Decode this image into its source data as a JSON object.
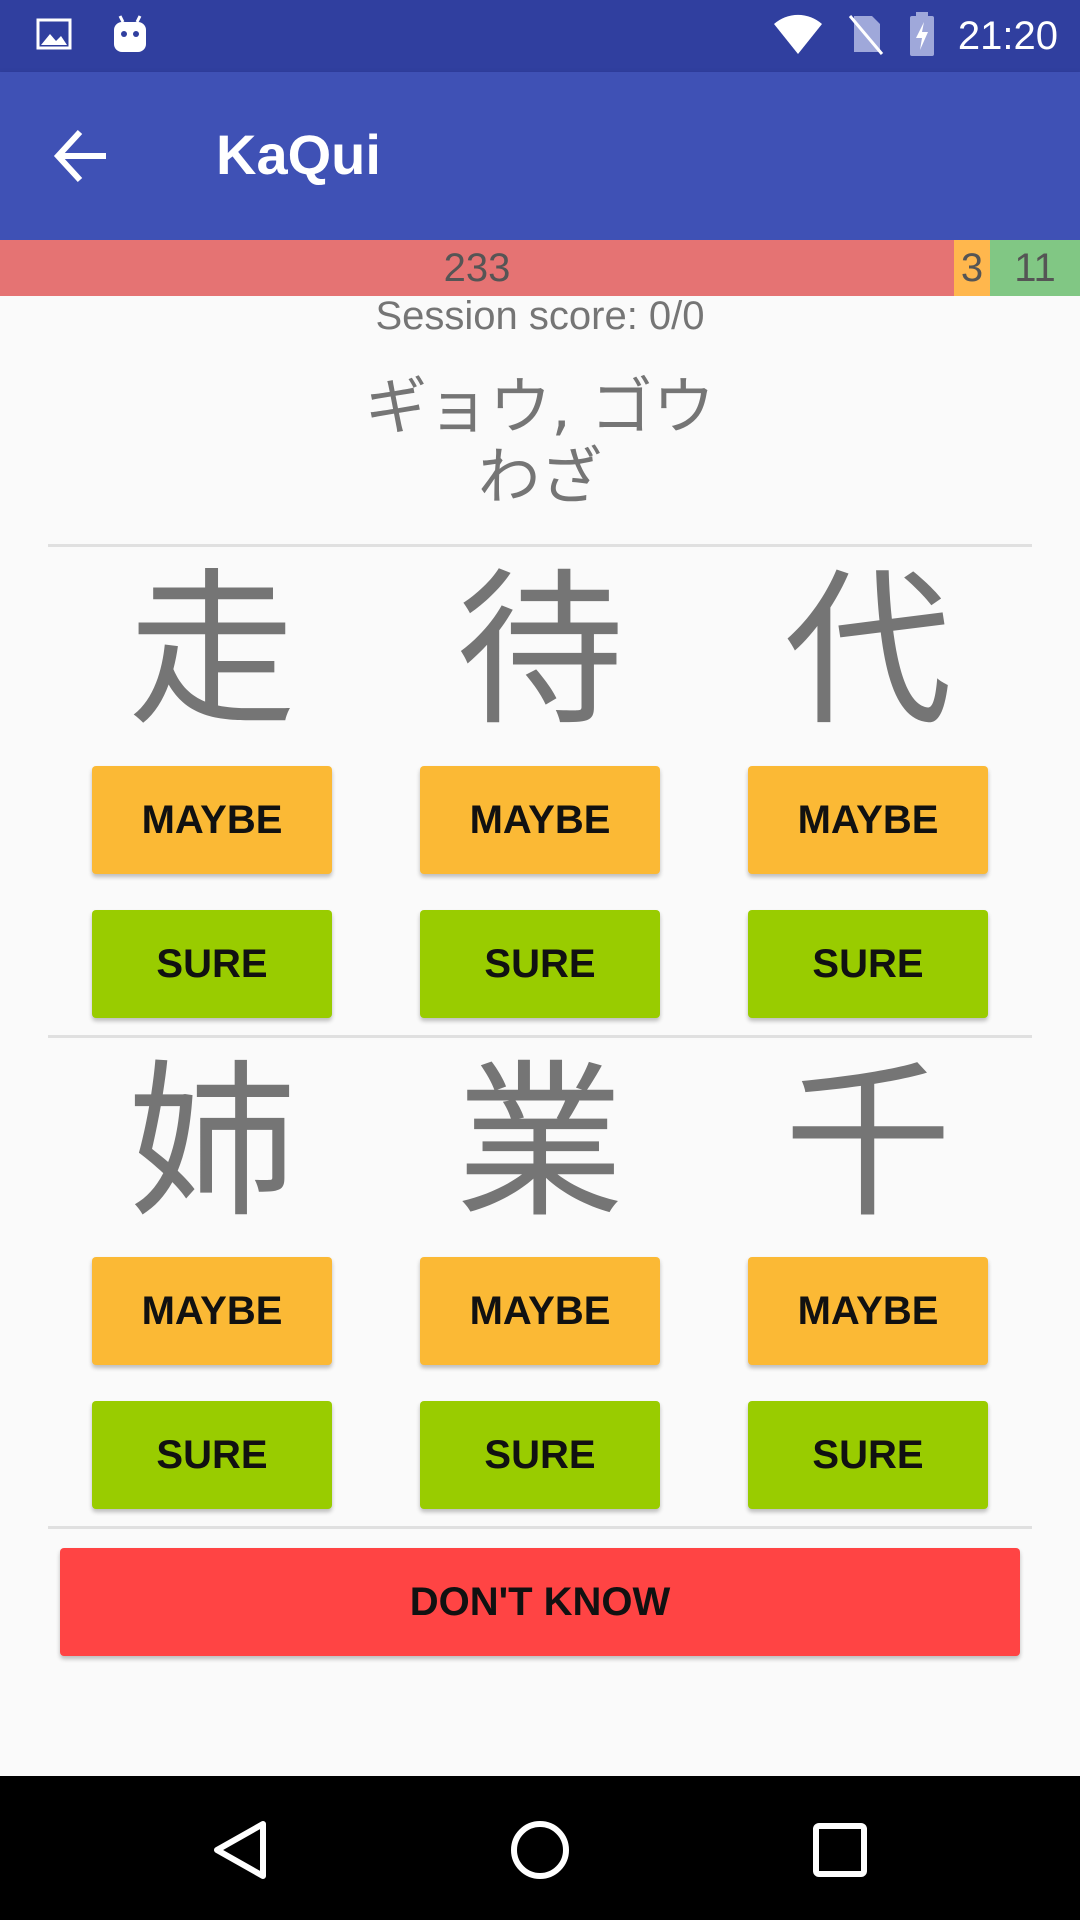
{
  "status_bar": {
    "time": "21:20",
    "left_icons": [
      "image-icon",
      "android-icon"
    ],
    "right_icons": [
      "wifi-icon",
      "no-sim-icon",
      "battery-charging-icon"
    ]
  },
  "app_bar": {
    "title": "KaQui",
    "back_icon": "arrow-back-icon"
  },
  "stats": {
    "bad": "233",
    "meh": "3",
    "good": "11"
  },
  "session_score": "Session score: 0/0",
  "question": {
    "line1": "ギョウ, ゴウ",
    "line2": "わざ"
  },
  "answers": [
    {
      "kanji": "走",
      "maybe_label": "MAYBE",
      "sure_label": "SURE"
    },
    {
      "kanji": "待",
      "maybe_label": "MAYBE",
      "sure_label": "SURE"
    },
    {
      "kanji": "代",
      "maybe_label": "MAYBE",
      "sure_label": "SURE"
    },
    {
      "kanji": "姉",
      "maybe_label": "MAYBE",
      "sure_label": "SURE"
    },
    {
      "kanji": "業",
      "maybe_label": "MAYBE",
      "sure_label": "SURE"
    },
    {
      "kanji": "千",
      "maybe_label": "MAYBE",
      "sure_label": "SURE"
    }
  ],
  "dont_know_label": "DON'T KNOW",
  "nav_bar": {
    "icons": [
      "back-triangle-icon",
      "home-circle-icon",
      "recents-square-icon"
    ]
  },
  "colors": {
    "status_bar": "#303f9f",
    "app_bar": "#3f51b5",
    "stat_bad": "#e57373",
    "stat_meh": "#ffb74d",
    "stat_good": "#81c784",
    "maybe": "#fbb935",
    "sure": "#99cc00",
    "dont_know": "#ff4444"
  }
}
